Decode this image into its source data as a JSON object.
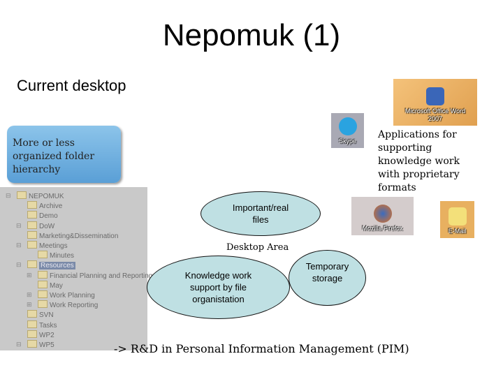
{
  "title": "Nepomuk (1)",
  "subtitle": "Current desktop",
  "folder_callout": "More or less organized folder hierarchy",
  "folder_tree": [
    {
      "label": "NEPOMUK",
      "level": 0,
      "expander": "⊟"
    },
    {
      "label": "Archive",
      "level": 1
    },
    {
      "label": "Demo",
      "level": 1
    },
    {
      "label": "DoW",
      "level": 1,
      "expander": "⊟"
    },
    {
      "label": "Marketing&Dissemination",
      "level": 1
    },
    {
      "label": "Meetings",
      "level": 1,
      "expander": "⊟"
    },
    {
      "label": "Minutes",
      "level": 2
    },
    {
      "label": "Resources",
      "level": 1,
      "expander": "⊟",
      "selected": true
    },
    {
      "label": "Financial Planning and Reporting",
      "level": 2,
      "expander": "⊞"
    },
    {
      "label": "May",
      "level": 2
    },
    {
      "label": "Work Planning",
      "level": 2,
      "expander": "⊞"
    },
    {
      "label": "Work Reporting",
      "level": 2,
      "expander": "⊞"
    },
    {
      "label": "SVN",
      "level": 1
    },
    {
      "label": "Tasks",
      "level": 1
    },
    {
      "label": "WP2",
      "level": 1
    },
    {
      "label": "WP5",
      "level": 1,
      "expander": "⊟"
    }
  ],
  "apps_label": "Applications for supporting knowledge work with proprietary formats",
  "desktop_icons": {
    "word": "Microsoft Office Word 2007",
    "skype": "Skype",
    "firefox": "Mozilla Firefox",
    "email": "E-Mail"
  },
  "ellipses": {
    "important": "Important/real files",
    "knowledge": "Knowledge work support by file organistation",
    "temporary": "Temporary storage"
  },
  "desktop_area": "Desktop Area",
  "footer": "-> R&D in Personal Information Management (PIM)"
}
